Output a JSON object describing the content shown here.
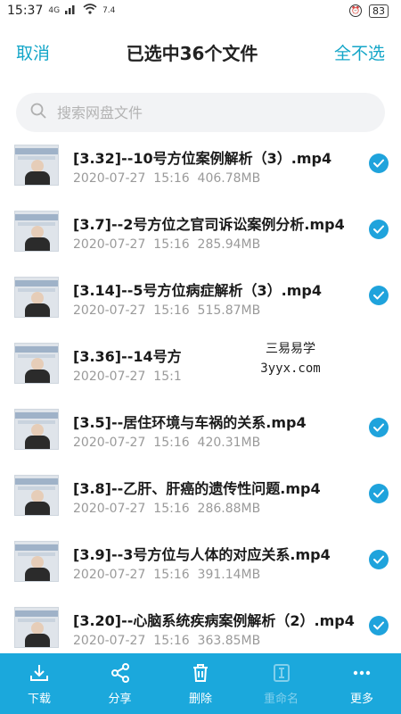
{
  "status": {
    "time": "15:37",
    "net": "4G",
    "speed": "7.4",
    "battery": "83"
  },
  "header": {
    "cancel_label": "取消",
    "title": "已选中36个文件",
    "deselect_label": "全不选"
  },
  "search": {
    "placeholder": "搜索网盘文件"
  },
  "files": [
    {
      "name": "[3.32]--10号方位案例解析（3）.mp4",
      "date": "2020-07-27",
      "time": "15:16",
      "size": "406.78MB"
    },
    {
      "name": "[3.7]--2号方位之官司诉讼案例分析.mp4",
      "date": "2020-07-27",
      "time": "15:16",
      "size": "285.94MB"
    },
    {
      "name": "[3.14]--5号方位病症解析（3）.mp4",
      "date": "2020-07-27",
      "time": "15:16",
      "size": "515.87MB"
    },
    {
      "name": "[3.36]--14号方",
      "date": "2020-07-27",
      "time": "15:1",
      "size": ""
    },
    {
      "name": "[3.5]--居住环境与车祸的关系.mp4",
      "date": "2020-07-27",
      "time": "15:16",
      "size": "420.31MB"
    },
    {
      "name": "[3.8]--乙肝、肝癌的遗传性问题.mp4",
      "date": "2020-07-27",
      "time": "15:16",
      "size": "286.88MB"
    },
    {
      "name": "[3.9]--3号方位与人体的对应关系.mp4",
      "date": "2020-07-27",
      "time": "15:16",
      "size": "391.14MB"
    },
    {
      "name": "[3.20]--心脑系统疾病案例解析（2）.mp4",
      "date": "2020-07-27",
      "time": "15:16",
      "size": "363.85MB"
    }
  ],
  "watermark": {
    "line1": "三易易学",
    "line2": "3yyx.com"
  },
  "toolbar": {
    "download": "下载",
    "share": "分享",
    "delete": "删除",
    "rename": "重命名",
    "more": "更多"
  },
  "colors": {
    "accent": "#14a6c8",
    "toolbar_bg": "#1ba8dc",
    "check_bg": "#1fa3dc"
  }
}
